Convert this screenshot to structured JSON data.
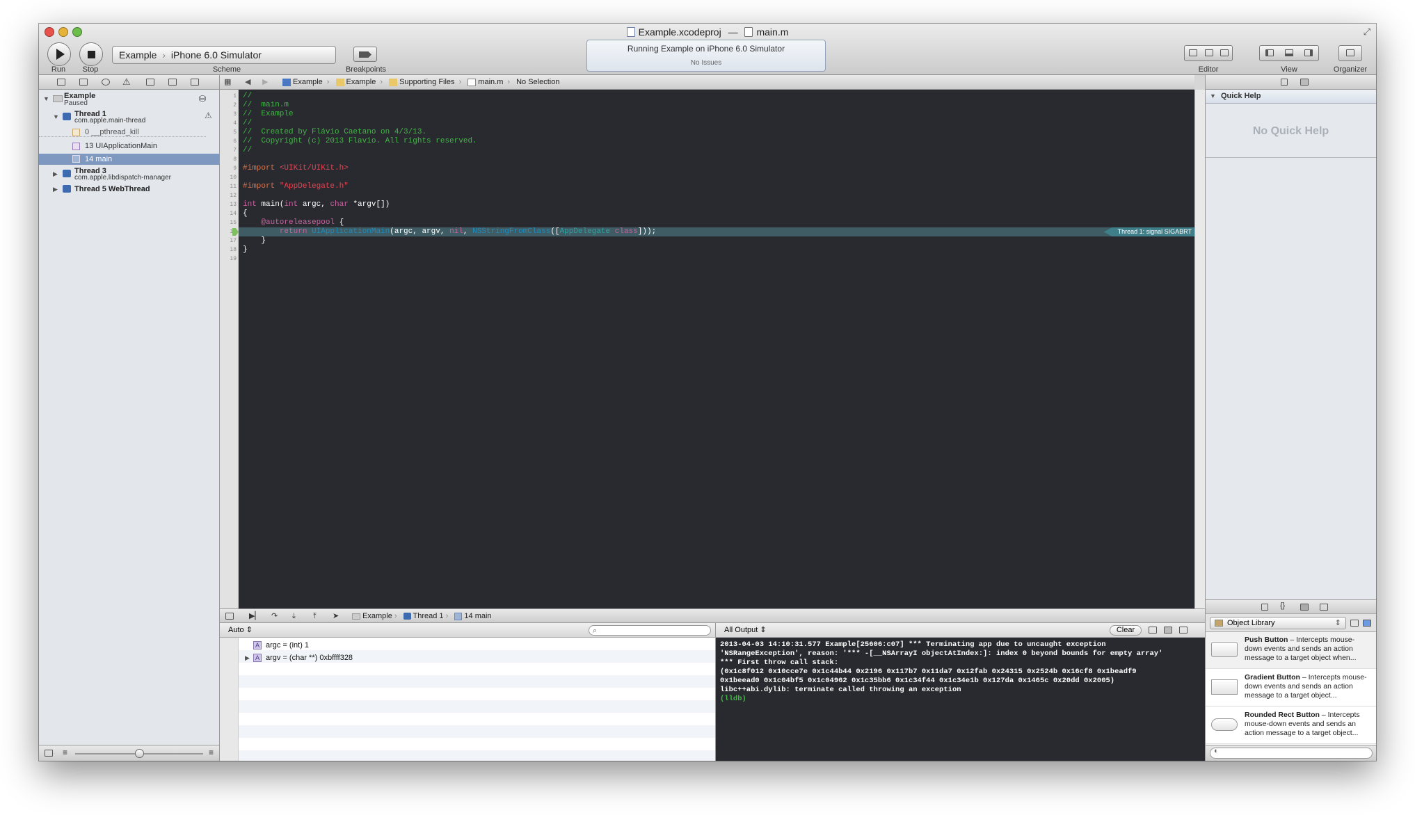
{
  "window": {
    "title_project": "Example.xcodeproj",
    "title_separator": "—",
    "title_file": "main.m"
  },
  "toolbar": {
    "run_label": "Run",
    "stop_label": "Stop",
    "scheme_label": "Scheme",
    "scheme_target": "Example",
    "scheme_destination": "iPhone 6.0 Simulator",
    "breakpoints_label": "Breakpoints",
    "status_title": "Running Example on iPhone 6.0 Simulator",
    "status_sub": "No Issues",
    "editor_label": "Editor",
    "view_label": "View",
    "organizer_label": "Organizer"
  },
  "navigator": {
    "process_name": "Example",
    "process_state": "Paused",
    "thread1_name": "Thread 1",
    "thread1_queue": "com.apple.main-thread",
    "frame0": "0 __pthread_kill",
    "frame13": "13 UIApplicationMain",
    "frame14": "14 main",
    "thread3_name": "Thread 3",
    "thread3_queue": "com.apple.libdispatch-manager",
    "thread5_name": "Thread 5 WebThread"
  },
  "jumpbar": {
    "crumbs": [
      "Example",
      "Example",
      "Supporting Files",
      "main.m",
      "No Selection"
    ]
  },
  "editor": {
    "line_numbers": [
      "1",
      "2",
      "3",
      "4",
      "5",
      "6",
      "7",
      "8",
      "9",
      "10",
      "11",
      "12",
      "13",
      "14",
      "15",
      "16",
      "17",
      "18",
      "19"
    ],
    "error_badge": "Thread 1: signal SIGABRT",
    "lines": [
      "//",
      "//  main.m",
      "//  Example",
      "//",
      "//  Created by Flávio Caetano on 4/3/13.",
      "//  Copyright (c) 2013 Flavio. All rights reserved.",
      "//",
      "",
      "#import <UIKit/UIKit.h>",
      "",
      "#import \"AppDelegate.h\"",
      "",
      "int main(int argc, char *argv[])",
      "{",
      "    @autoreleasepool {",
      "        return UIApplicationMain(argc, argv, nil, NSStringFromClass([AppDelegate class]));",
      "    }",
      "}",
      ""
    ]
  },
  "debugbar": {
    "crumb_process": "Example",
    "crumb_thread": "Thread 1",
    "crumb_frame": "14 main"
  },
  "variables": {
    "scope": "Auto",
    "rows": [
      {
        "icon": "A",
        "text": "argc = (int) 1"
      },
      {
        "icon": "A",
        "text": "argv = (char **) 0xbffff328"
      }
    ]
  },
  "console": {
    "filter": "All Output",
    "clear_label": "Clear",
    "output": "2013-04-03 14:10:31.577 Example[25606:c07] *** Terminating app due to uncaught exception\n'NSRangeException', reason: '*** -[__NSArrayI objectAtIndex:]: index 0 beyond bounds for empty array'\n*** First throw call stack:\n(0x1c8f012 0x10cce7e 0x1c44b44 0x2196 0x117b7 0x11da7 0x12fab 0x24315 0x2524b 0x16cf8 0x1beadf9\n0x1beead0 0x1c04bf5 0x1c04962 0x1c35bb6 0x1c34f44 0x1c34e1b 0x127da 0x1465c 0x20dd 0x2005)\nlibc++abi.dylib: terminate called throwing an exception",
    "prompt": "(lldb)"
  },
  "quickhelp": {
    "title": "Quick Help",
    "empty": "No Quick Help"
  },
  "library": {
    "selector": "Object Library",
    "items": [
      {
        "name": "Push Button",
        "desc": " – Intercepts mouse-down events and sends an action message to a target object when..."
      },
      {
        "name": "Gradient Button",
        "desc": " – Intercepts mouse-down events and sends an action message to a target object..."
      },
      {
        "name": "Rounded Rect Button",
        "desc": " – Intercepts mouse-down events and sends an action message to a target object..."
      }
    ]
  },
  "colors": {
    "editor_bg": "#292a30",
    "comment": "#41b645",
    "preprocessor": "#d6734d",
    "string": "#e8434f",
    "keyword": "#c7639f",
    "error_line": "#3f5b63"
  }
}
